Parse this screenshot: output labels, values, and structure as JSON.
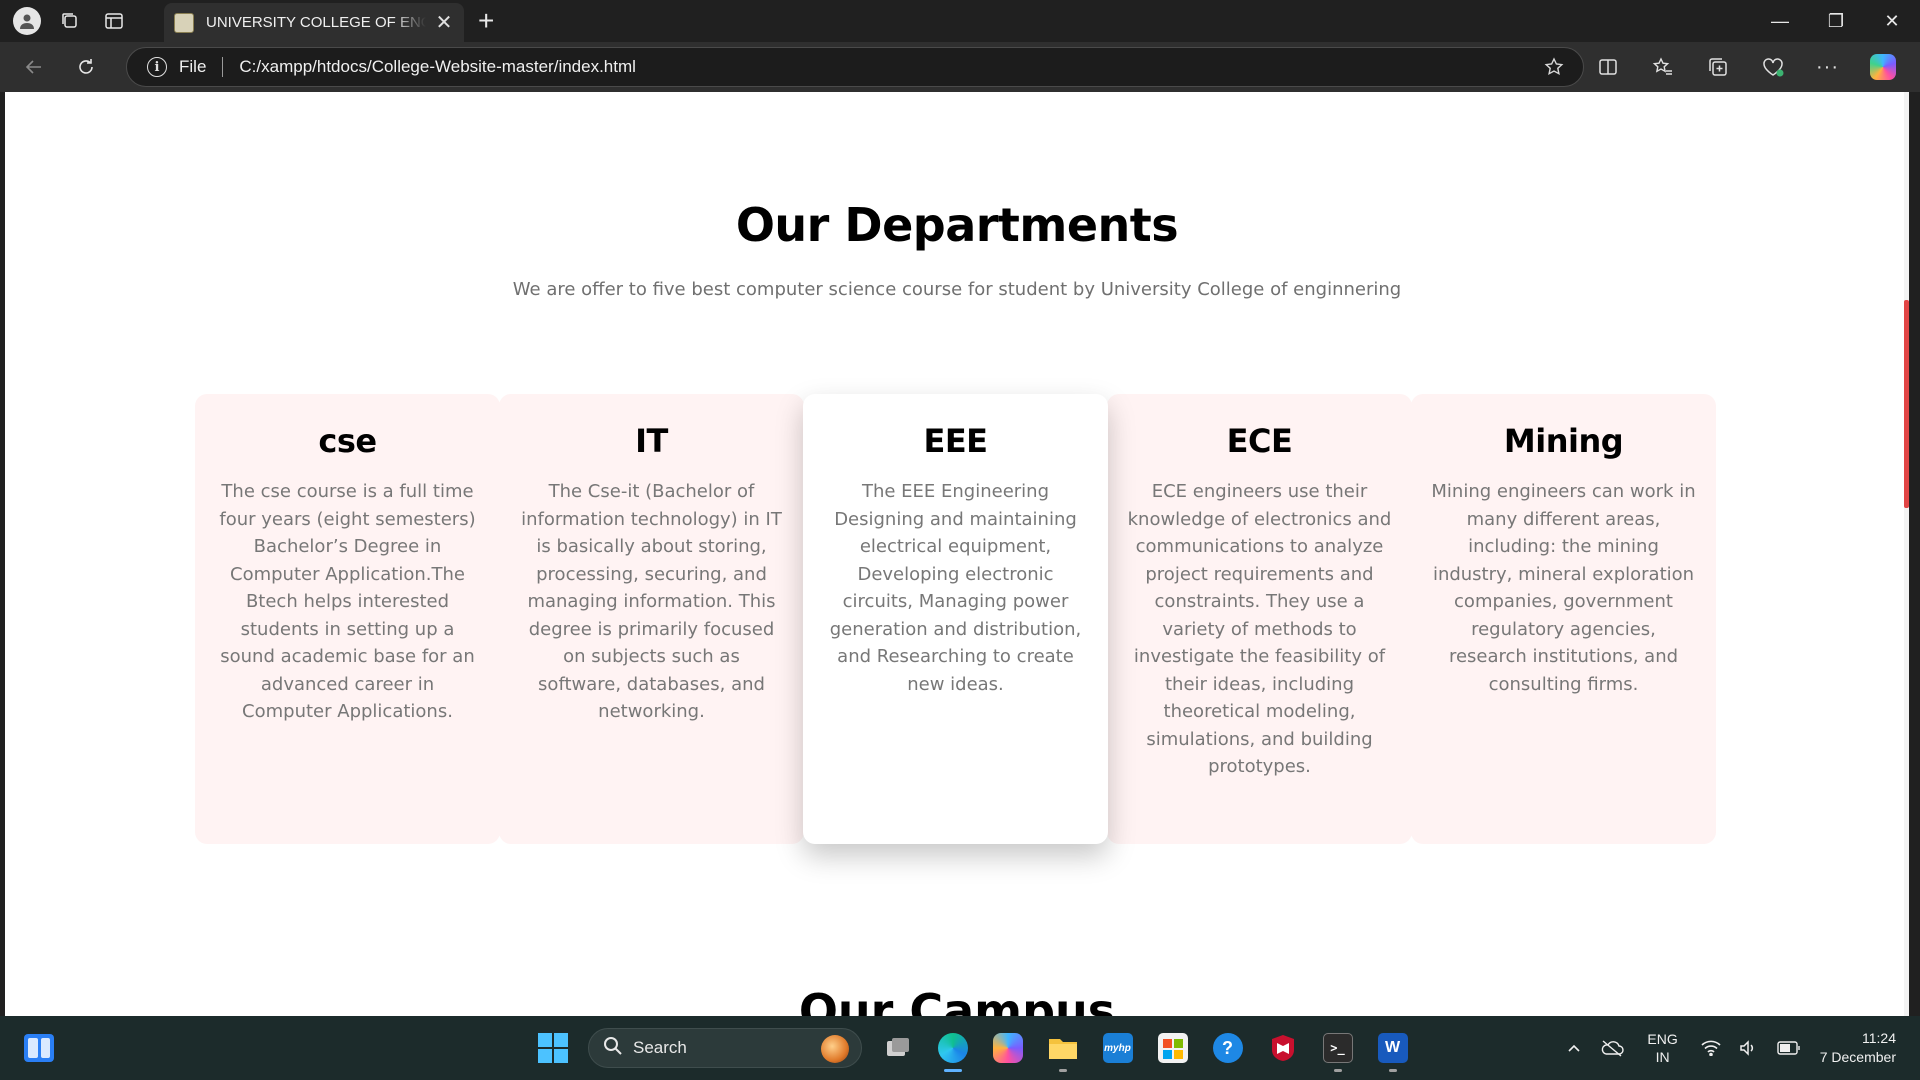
{
  "browser": {
    "tab_title": "UNIVERSITY COLLEGE OF ENGINEERING",
    "address_prefix": "File",
    "url": "C:/xampp/htdocs/College-Website-master/index.html"
  },
  "page": {
    "departments_heading": "Our Departments",
    "departments_subtitle": "We are offer to five best computer science course for student by University College of enginnering",
    "departments": [
      {
        "name": "cse",
        "description": "The cse course is a full time four years (eight semesters) Bachelor’s Degree in Computer Application.The Btech helps interested students in setting up a sound academic base for an advanced career in Computer Applications."
      },
      {
        "name": "IT",
        "description": "The Cse-it (Bachelor of information technology) in IT is basically about storing, processing, securing, and managing information. This degree is primarily focused on subjects such as software, databases, and networking."
      },
      {
        "name": "EEE",
        "description": "The EEE Engineering Designing and maintaining electrical equipment, Developing electronic circuits, Managing power generation and distribution, and Researching to create new ideas."
      },
      {
        "name": "ECE",
        "description": "ECE engineers use their knowledge of electronics and communications to analyze project requirements and constraints. They use a variety of methods to investigate the feasibility of their ideas, including theoretical modeling, simulations, and building prototypes."
      },
      {
        "name": "Mining",
        "description": "Mining engineers can work in many different areas, including: the mining industry, mineral exploration companies, government regulatory agencies, research institutions, and consulting firms."
      }
    ],
    "campus_heading": "Our Campus"
  },
  "taskbar": {
    "search_label": "Search",
    "language_line1": "ENG",
    "language_line2": "IN",
    "time": "11:24",
    "date": "7 December"
  },
  "colors": {
    "card_bg": "#fff3f3",
    "scroll_thumb": "#e14545",
    "accent": "#4cc2ff"
  }
}
